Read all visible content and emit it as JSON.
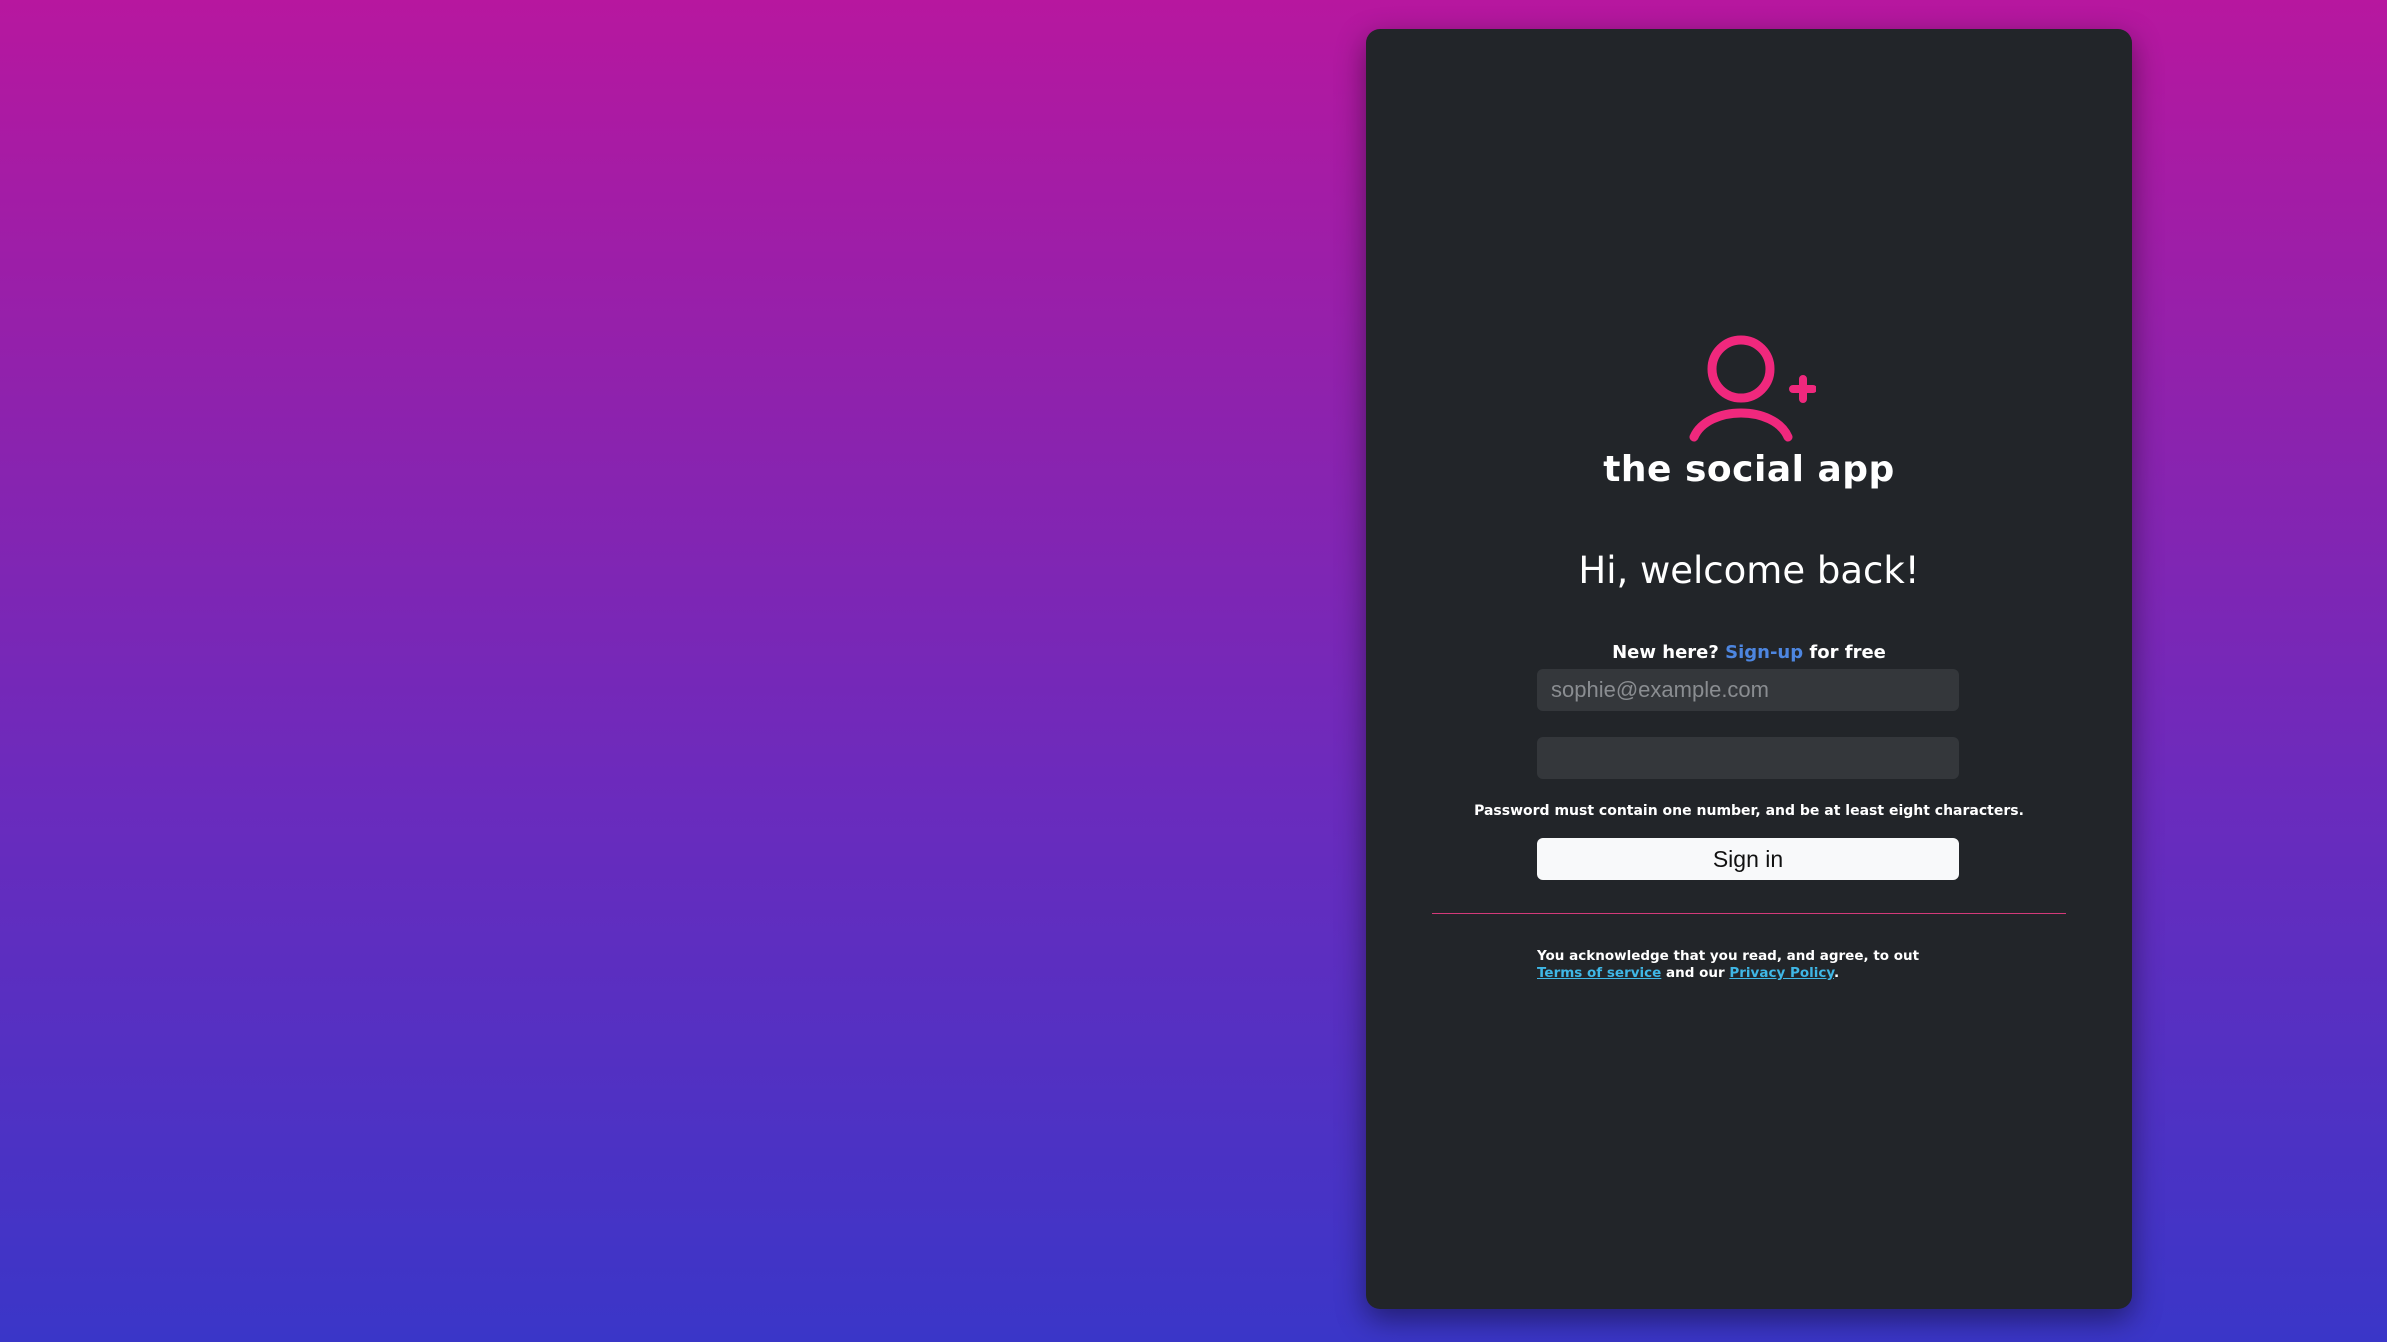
{
  "brand": {
    "name": "the social app",
    "logo_icon": "user-plus-icon",
    "accent_color": "#f0287d"
  },
  "welcome": {
    "title": "Hi, welcome back!",
    "new_here": "New here?",
    "signup_link": "Sign-up",
    "for_free": "for free"
  },
  "form": {
    "email_placeholder": "sophie@example.com",
    "email_value": "",
    "password_placeholder": "",
    "password_value": "",
    "password_hint": "Password must contain one number, and be at least eight characters.",
    "signin_label": "Sign in"
  },
  "legal": {
    "text_before": "You acknowledge that you read, and agree, to out",
    "terms_link": "Terms of service",
    "text_middle": "and our",
    "privacy_link": "Privacy Policy",
    "text_end": "."
  },
  "colors": {
    "link": "#4d86e0",
    "legal_link": "#3fb7e6",
    "divider": "#d43a7a",
    "card_bg": "#222529"
  }
}
